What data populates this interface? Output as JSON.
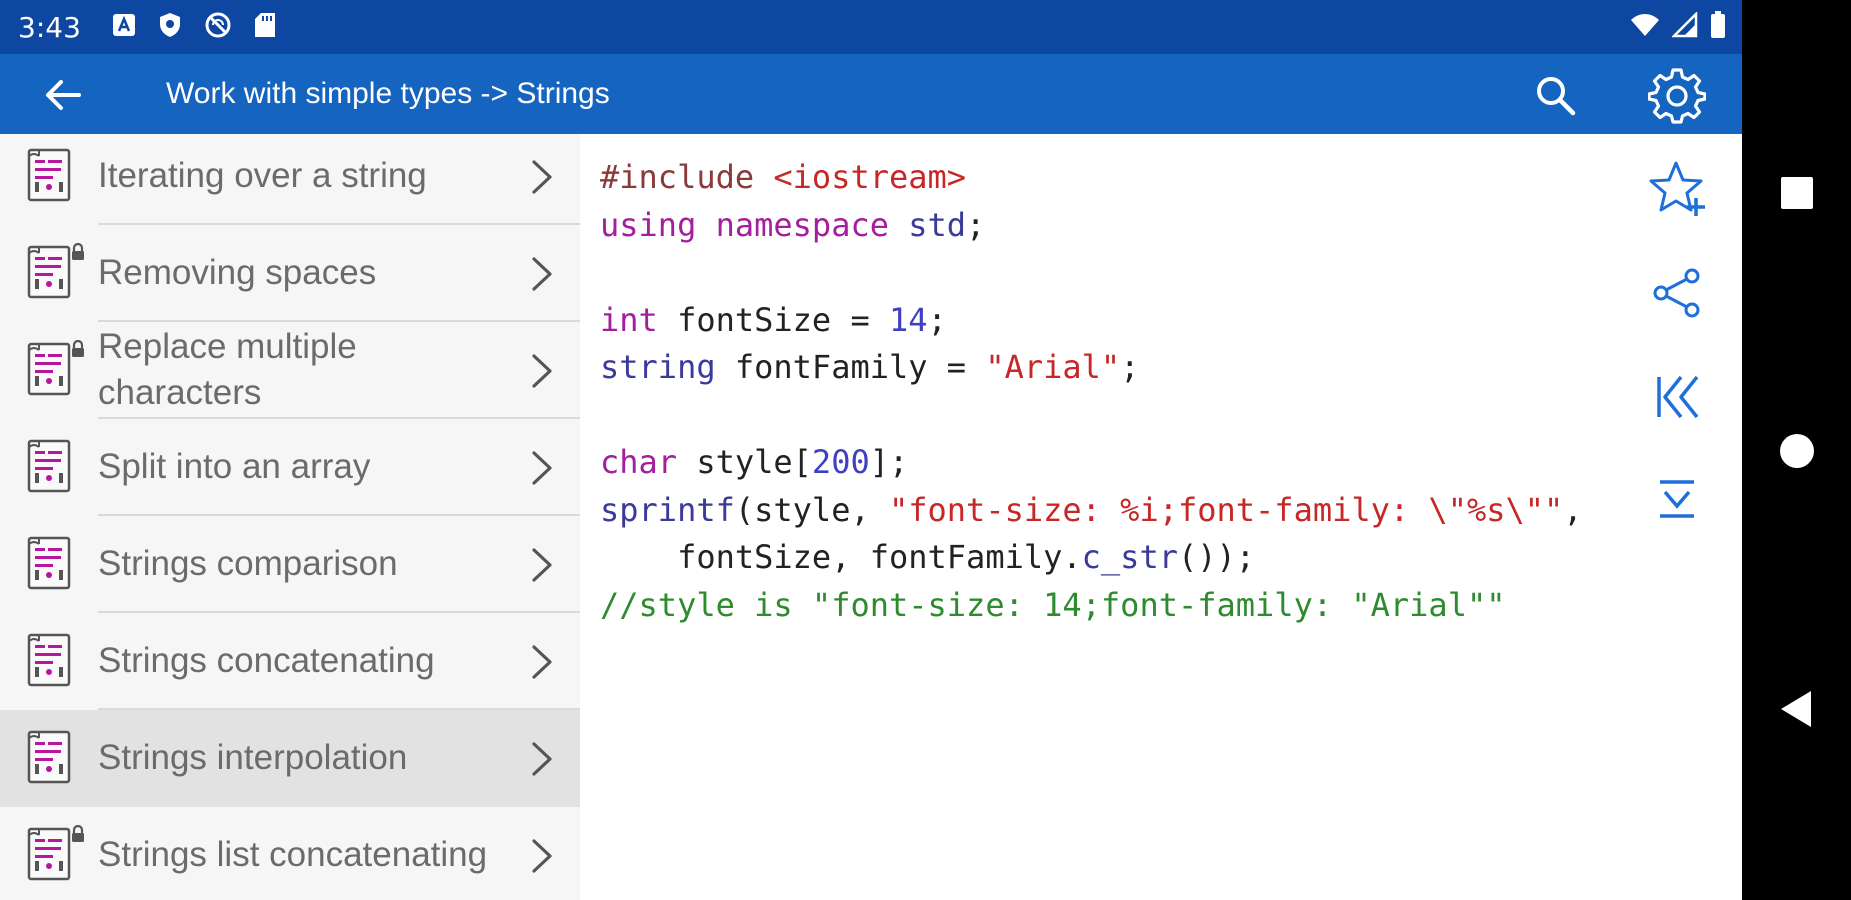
{
  "status_bar": {
    "time": "3:43",
    "icons": [
      "notification-a-icon",
      "shield-icon",
      "no-sync-icon",
      "sd-card-icon",
      "wifi-icon",
      "signal-icon",
      "battery-icon"
    ]
  },
  "app_bar": {
    "title": "Work with simple types -> Strings",
    "icons": [
      "back-arrow-icon",
      "search-icon",
      "gear-icon"
    ]
  },
  "topics": [
    {
      "label": "Iterating over a string",
      "locked": false,
      "selected": false
    },
    {
      "label": "Removing spaces",
      "locked": true,
      "selected": false
    },
    {
      "label": "Replace multiple characters",
      "locked": true,
      "selected": false
    },
    {
      "label": "Split into an array",
      "locked": false,
      "selected": false
    },
    {
      "label": "Strings comparison",
      "locked": false,
      "selected": false
    },
    {
      "label": "Strings concatenating",
      "locked": false,
      "selected": false
    },
    {
      "label": "Strings interpolation",
      "locked": false,
      "selected": true
    },
    {
      "label": "Strings list concatenating",
      "locked": true,
      "selected": false
    }
  ],
  "code_lines": [
    [
      {
        "t": "pre",
        "v": "#include "
      },
      {
        "t": "str",
        "v": "<iostream>"
      }
    ],
    [
      {
        "t": "kw",
        "v": "using"
      },
      {
        "t": "plain",
        "v": " "
      },
      {
        "t": "kw",
        "v": "namespace"
      },
      {
        "t": "plain",
        "v": " "
      },
      {
        "t": "fn",
        "v": "std"
      },
      {
        "t": "plain",
        "v": ";"
      }
    ],
    [],
    [
      {
        "t": "kw",
        "v": "int"
      },
      {
        "t": "plain",
        "v": " fontSize = "
      },
      {
        "t": "num",
        "v": "14"
      },
      {
        "t": "plain",
        "v": ";"
      }
    ],
    [
      {
        "t": "fn",
        "v": "string"
      },
      {
        "t": "plain",
        "v": " fontFamily = "
      },
      {
        "t": "str",
        "v": "\"Arial\""
      },
      {
        "t": "plain",
        "v": ";"
      }
    ],
    [],
    [
      {
        "t": "kw",
        "v": "char"
      },
      {
        "t": "plain",
        "v": " style["
      },
      {
        "t": "num",
        "v": "200"
      },
      {
        "t": "plain",
        "v": "];"
      }
    ],
    [
      {
        "t": "fn",
        "v": "sprintf"
      },
      {
        "t": "plain",
        "v": "(style, "
      },
      {
        "t": "str",
        "v": "\"font-size: %i;font-family: \\\"%s\\\"\""
      },
      {
        "t": "plain",
        "v": ","
      }
    ],
    [
      {
        "t": "plain",
        "v": "    fontSize, fontFamily."
      },
      {
        "t": "fn",
        "v": "c_str"
      },
      {
        "t": "plain",
        "v": "());"
      }
    ],
    [
      {
        "t": "cm",
        "v": "//style is \"font-size: 14;font-family: \"Arial\"\""
      }
    ]
  ],
  "side_actions": [
    "star-add-icon",
    "share-icon",
    "skip-to-first-icon",
    "scroll-to-end-icon"
  ],
  "nav_bar": [
    "recents-square-icon",
    "home-circle-icon",
    "back-triangle-icon"
  ],
  "colors": {
    "status_bar": "#0d47a1",
    "app_bar": "#1565c0",
    "accent_icon": "#1e6fd9",
    "icon_magenta": "#b5179e"
  }
}
